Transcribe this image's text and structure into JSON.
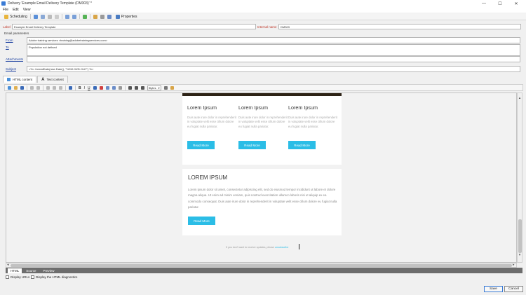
{
  "window": {
    "title": "Delivery 'Example Email Delivery Template (DM303)' *",
    "controls": [
      "—",
      "☐",
      "✕"
    ]
  },
  "menu": [
    "File",
    "Edit",
    "View"
  ],
  "toolbar": {
    "scheduling_label": "Scheduling",
    "properties_label": "Properties"
  },
  "form": {
    "label_caption": "Label",
    "label_value": "Example Email Delivery Template",
    "internal_name_caption": "Internal name",
    "internal_name_value": "DM303",
    "email_params_heading": "Email parameters",
    "from_caption": "From",
    "from_value": "Adobe training services <training@adobetrainingservices.com>",
    "to_caption": "To",
    "to_value": "Population not defined",
    "attachments_caption": "Attachments",
    "subject_caption": "Subject",
    "subject_value": "<%= formatDate(new Date(), \"%2M-%2D-%4Y\") %>"
  },
  "content_tabs": [
    "HTML content",
    "Text content"
  ],
  "editor_toolbar": {
    "styles_label": "Styles"
  },
  "email": {
    "columns": [
      {
        "heading": "Lorem Ipsum",
        "text": "Duis aute irure dolor in reprehenderit in voluptate velit esse cillum dolore eu fugiat nulla pariatur.",
        "button": "Read More"
      },
      {
        "heading": "Lorem Ipsum",
        "text": "Duis aute irure dolor in reprehenderit in voluptate velit esse cillum dolore eu fugiat nulla pariatur.",
        "button": "Read More"
      },
      {
        "heading": "Lorem Ipsum",
        "text": "Duis aute irure dolor in reprehenderit in voluptate velit esse cillum dolore eu fugiat nulla pariatur.",
        "button": "Read More"
      }
    ],
    "section_title": "LOREM IPSUM",
    "section_body": "Lorem ipsum dolor sit amet, consectetur adipiscing elit, sed do eiusmod tempor incididunt ut labore et dolore magna aliqua. Ut enim ad minim veniam, quis nostrud exercitation ullamco laboris nisi ut aliquip ex ea commodo consequat. Duis aute irure dolor in reprehenderit in voluptate velit esse cillum dolore eu fugiat nulla pariatur.",
    "section_button": "Read More",
    "footer_text": "If you don't want to receive updates, please",
    "footer_link": "unsubscribe"
  },
  "view_tabs": [
    "HTML",
    "Source",
    "Preview"
  ],
  "options": {
    "display_urls": "Display URLs",
    "html_diagnostics": "Display the HTML diagnostics"
  },
  "actions": {
    "save": "Save",
    "cancel": "Cancel"
  },
  "colors": {
    "accent_button": "#2bbde6",
    "label_red": "#c0392b",
    "link_blue": "#1a3fa0"
  }
}
